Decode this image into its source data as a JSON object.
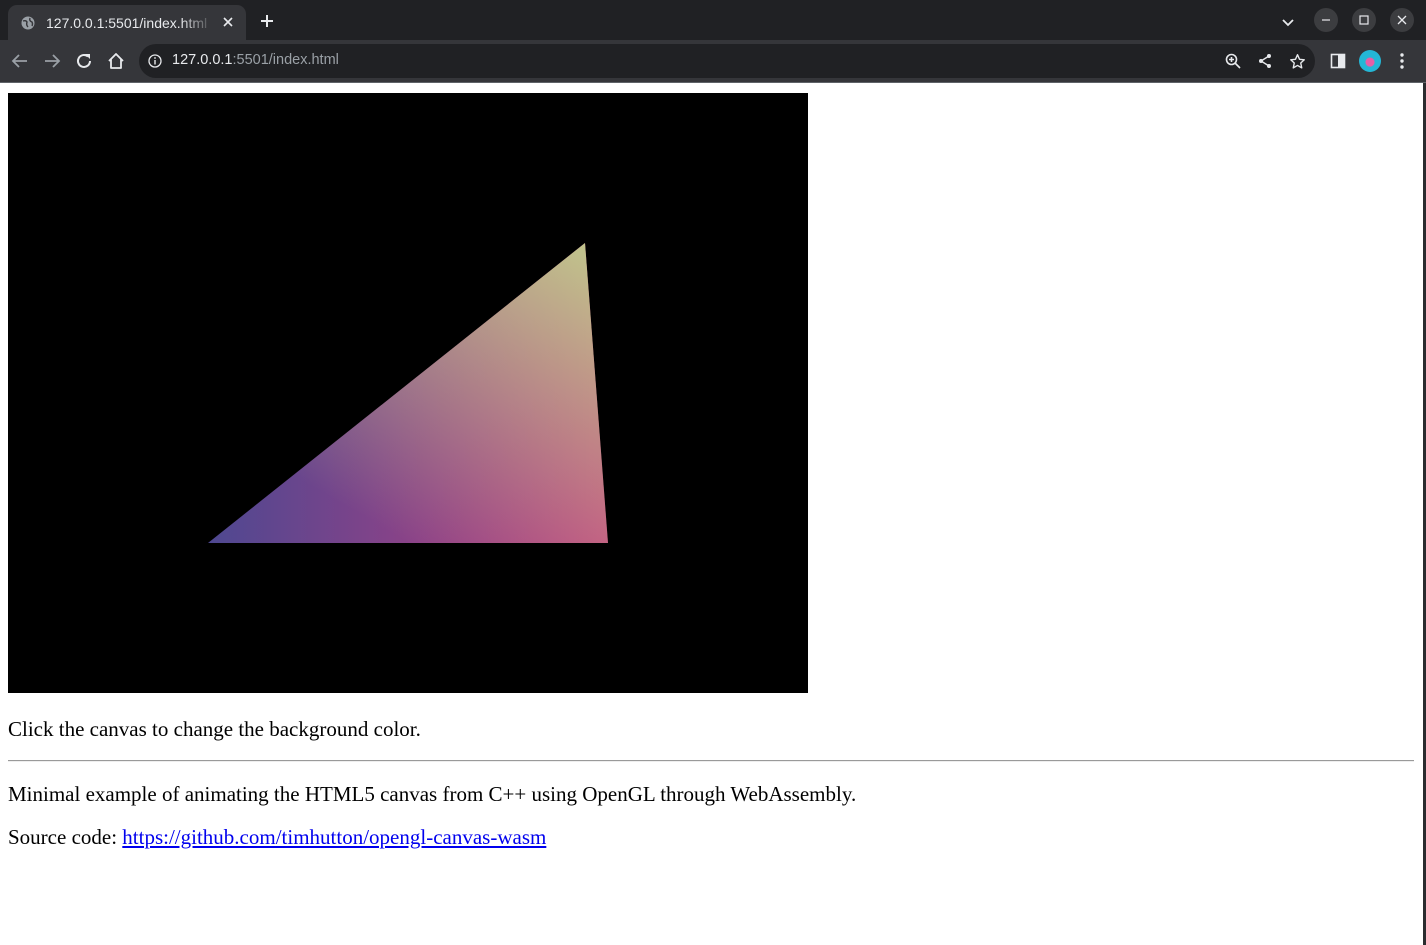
{
  "browser": {
    "tab": {
      "title": "127.0.0.1:5501/index.html",
      "favicon": "globe-icon",
      "close_icon": "close-icon"
    },
    "new_tab_icon": "plus-icon",
    "tab_search_icon": "chevron-down-icon",
    "window_controls": [
      "minimize-icon",
      "maximize-icon",
      "close-icon"
    ],
    "nav_icons": [
      "back-arrow-icon",
      "forward-arrow-icon",
      "reload-icon",
      "home-icon"
    ],
    "omnibox": {
      "info_icon": "info-icon",
      "url_host": "127.0.0.1",
      "url_rest": ":5501/index.html",
      "action_icons": [
        "zoom-icon",
        "share-icon",
        "star-icon"
      ]
    },
    "toolbar_icons": [
      "side-panel-icon",
      "profile-avatar",
      "kebab-menu-icon"
    ],
    "colors": {
      "tabstrip_bg": "#202124",
      "toolbar_bg": "#35363a",
      "omnibox_bg": "#202124",
      "text_primary": "#e8eaed",
      "text_secondary": "#9aa0a6"
    }
  },
  "page": {
    "canvas": {
      "background": "#000000",
      "triangle_gradient_colors": [
        "#4e4891",
        "#c43d7f",
        "#c0c48c"
      ]
    },
    "instruction_text": "Click the canvas to change the background color.",
    "description_text": "Minimal example of animating the HTML5 canvas from C++ using OpenGL through WebAssembly.",
    "source_label": "Source code: ",
    "source_link_text": "https://github.com/timhutton/opengl-canvas-wasm",
    "link_color": "#0000ee"
  }
}
